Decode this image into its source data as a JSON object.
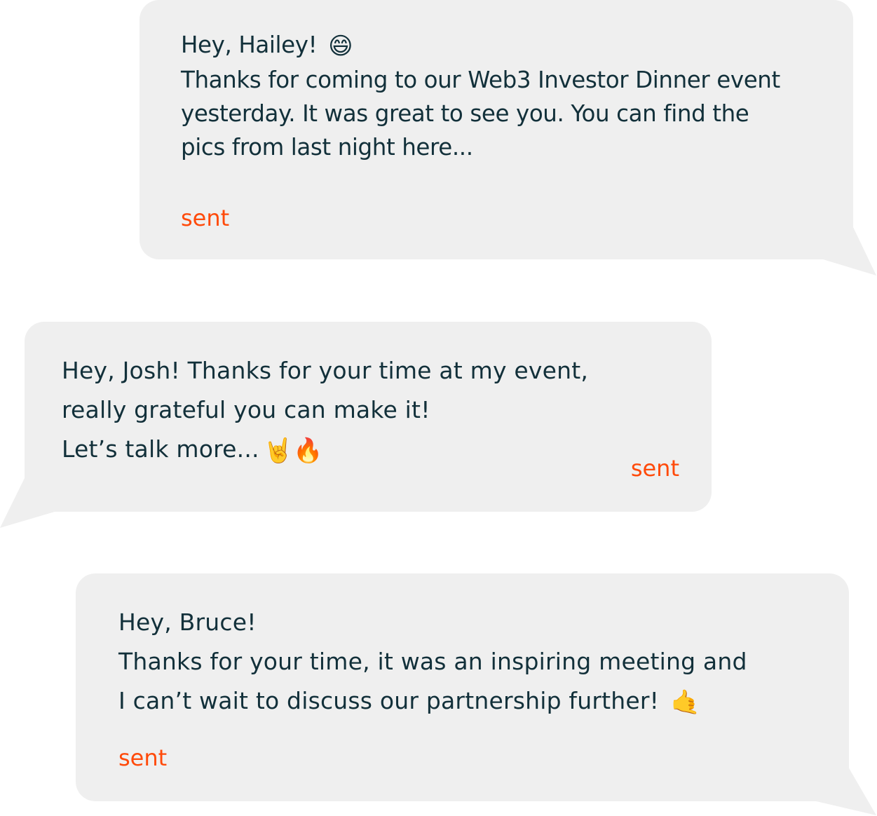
{
  "messages": [
    {
      "lines": [
        "Hey, Hailey! ",
        "Thanks for coming to our Web3 Investor Dinner event",
        "yesterday. It was great to see you. You can find the",
        "pics from last night here..."
      ],
      "emoji": "😄",
      "status": "sent"
    },
    {
      "lines": [
        "Hey, Josh! Thanks for your time at my event,",
        "really grateful you can make it!",
        "Let’s talk more..."
      ],
      "emoji": "🤘🔥",
      "status": "sent"
    },
    {
      "lines": [
        "Hey, Bruce!",
        "Thanks for your time, it was an inspiring meeting and",
        "I can’t wait to discuss our partnership further! "
      ],
      "emoji": "🤙",
      "status": "sent"
    }
  ],
  "colors": {
    "bubble": "#efefef",
    "text": "#12303a",
    "status": "#ff4a0a"
  }
}
